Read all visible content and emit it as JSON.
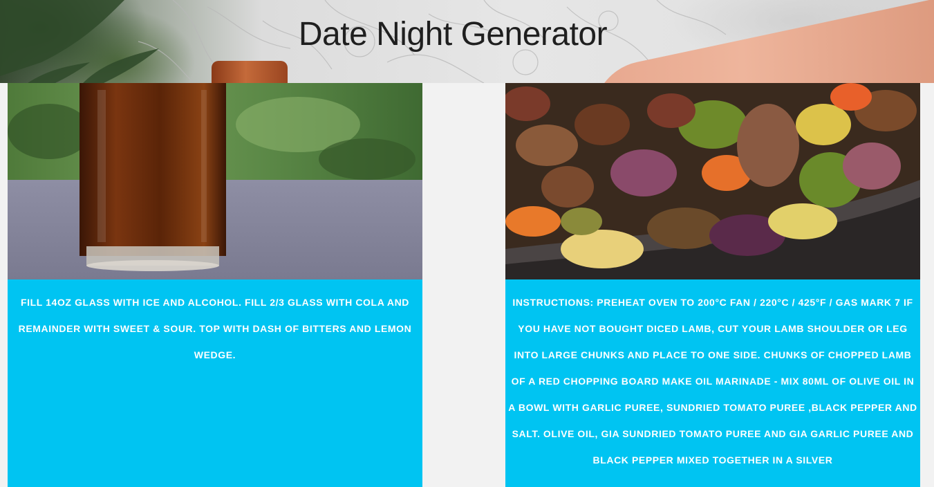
{
  "header": {
    "title": "Date Night Generator"
  },
  "drink": {
    "image_icon": "cola-glass-photo",
    "instructions": "Fill 14oz glass with ice and alcohol. Fill 2/3 glass with cola and remainder with sweet & sour. Top with dash of bitters and lemon wedge."
  },
  "meal": {
    "image_icon": "roasted-lamb-vegetables-photo",
    "instructions": "Instructions: Preheat oven to 200°C Fan / 220°C / 425°F / Gas Mark 7 If you have not bought diced lamb, cut your lamb shoulder or leg into large chunks and place to one side. Chunks of chopped lamb of a red chopping board Make oil marinade - Mix 80ml of olive oil in a bowl with garlic puree, sundried tomato puree ,black pepper and salt. Olive oil, Gia sundried tomato puree and Gia garlic puree and black pepper mixed together in a silver"
  },
  "colors": {
    "text_panel": "#00c4f2",
    "background": "#f2f2f2",
    "title_text": "#1f1f1f"
  }
}
